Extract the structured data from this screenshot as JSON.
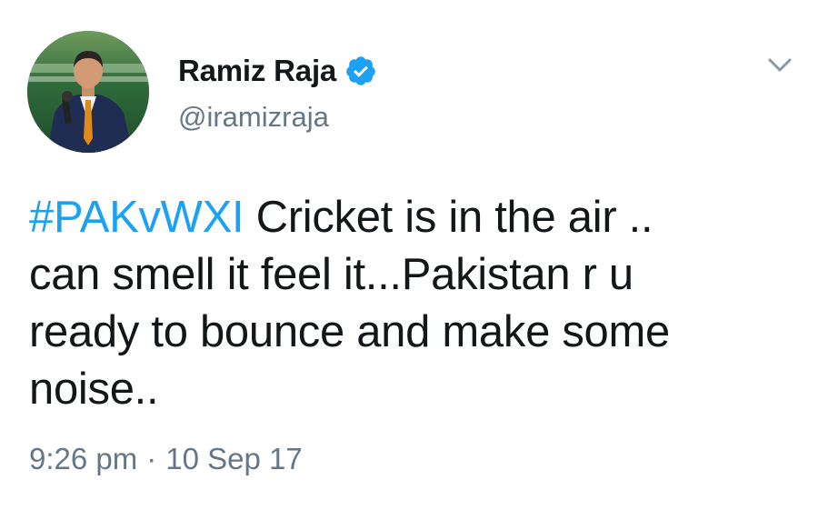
{
  "author": {
    "display_name": "Ramiz Raja",
    "handle": "@iramizraja",
    "verified": true,
    "verified_icon": "verified-badge-icon",
    "avatar_icon": "profile-photo"
  },
  "tweet": {
    "hashtag": "#PAKvWXI",
    "text_lines": [
      " Cricket is in the air ..",
      "can smell it feel it...Pakistan r u",
      "ready to bounce and make some",
      "noise.."
    ]
  },
  "meta": {
    "time": "9:26 pm",
    "separator": "·",
    "date": "10 Sep 17"
  },
  "menu": {
    "icon": "chevron-down-icon"
  },
  "colors": {
    "link": "#1da1f2",
    "secondary_text": "#657786",
    "primary_text": "#14171a",
    "verified_badge": "#1da1f2"
  }
}
